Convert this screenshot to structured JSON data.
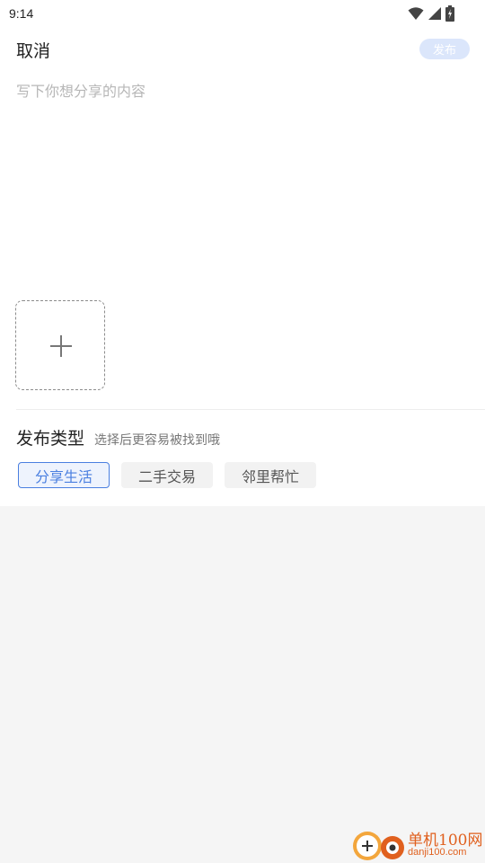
{
  "status_bar": {
    "time": "9:14"
  },
  "header": {
    "cancel_label": "取消",
    "publish_label": "发布"
  },
  "composer": {
    "placeholder": "写下你想分享的内容",
    "value": ""
  },
  "media": {
    "add_icon": "plus-icon"
  },
  "publish_type": {
    "title": "发布类型",
    "hint": "选择后更容易被找到哦",
    "options": [
      {
        "label": "分享生活",
        "selected": true
      },
      {
        "label": "二手交易",
        "selected": false
      },
      {
        "label": "邻里帮忙",
        "selected": false
      }
    ]
  },
  "watermark": {
    "name": "单机100网",
    "domain": "danji100.com"
  },
  "colors": {
    "accent": "#4a7fe0",
    "publish_button_bg": "#dbe6fb",
    "page_bg": "#f5f5f5",
    "panel_bg": "#ffffff"
  }
}
